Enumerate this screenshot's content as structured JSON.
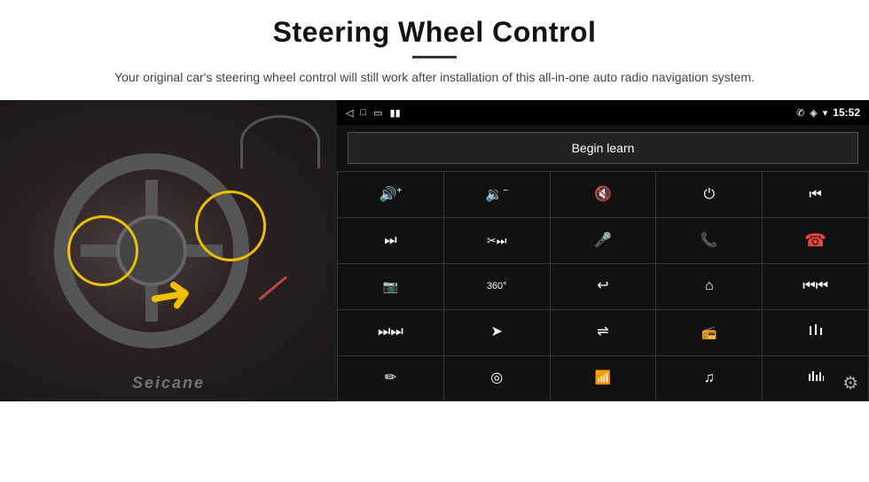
{
  "header": {
    "title": "Steering Wheel Control",
    "subtitle": "Your original car's steering wheel control will still work after installation of this all-in-one auto radio navigation system."
  },
  "status_bar": {
    "time": "15:52",
    "back_icon": "◁",
    "home_icon": "□",
    "recents_icon": "▭",
    "signal_icon": "▮▮",
    "phone_icon": "✆",
    "location_icon": "◈",
    "wifi_icon": "▾"
  },
  "begin_learn_label": "Begin learn",
  "controls": [
    {
      "icon": "🔊+",
      "label": "vol-up"
    },
    {
      "icon": "🔉−",
      "label": "vol-down"
    },
    {
      "icon": "🔇",
      "label": "vol-mute"
    },
    {
      "icon": "⏻",
      "label": "power"
    },
    {
      "icon": "⏮",
      "label": "prev-track"
    },
    {
      "icon": "⏭",
      "label": "next"
    },
    {
      "icon": "⏭⏭",
      "label": "fast-forward"
    },
    {
      "icon": "🎤",
      "label": "mic"
    },
    {
      "icon": "📞",
      "label": "phone"
    },
    {
      "icon": "📴",
      "label": "hang-up"
    },
    {
      "icon": "📷",
      "label": "camera"
    },
    {
      "icon": "360",
      "label": "360-view"
    },
    {
      "icon": "↩",
      "label": "back"
    },
    {
      "icon": "⌂",
      "label": "home"
    },
    {
      "icon": "⏮⏮",
      "label": "prev"
    },
    {
      "icon": "⏭⏭",
      "label": "skip"
    },
    {
      "icon": "➤",
      "label": "nav"
    },
    {
      "icon": "⇌",
      "label": "toggle"
    },
    {
      "icon": "📻",
      "label": "radio"
    },
    {
      "icon": "⇅",
      "label": "eq"
    },
    {
      "icon": "✏",
      "label": "draw"
    },
    {
      "icon": "◎",
      "label": "circle"
    },
    {
      "icon": "✦",
      "label": "bluetooth"
    },
    {
      "icon": "♫",
      "label": "music"
    },
    {
      "icon": "▐▌",
      "label": "equalizer"
    }
  ],
  "watermark": "Seicane",
  "gear_label": "⚙"
}
